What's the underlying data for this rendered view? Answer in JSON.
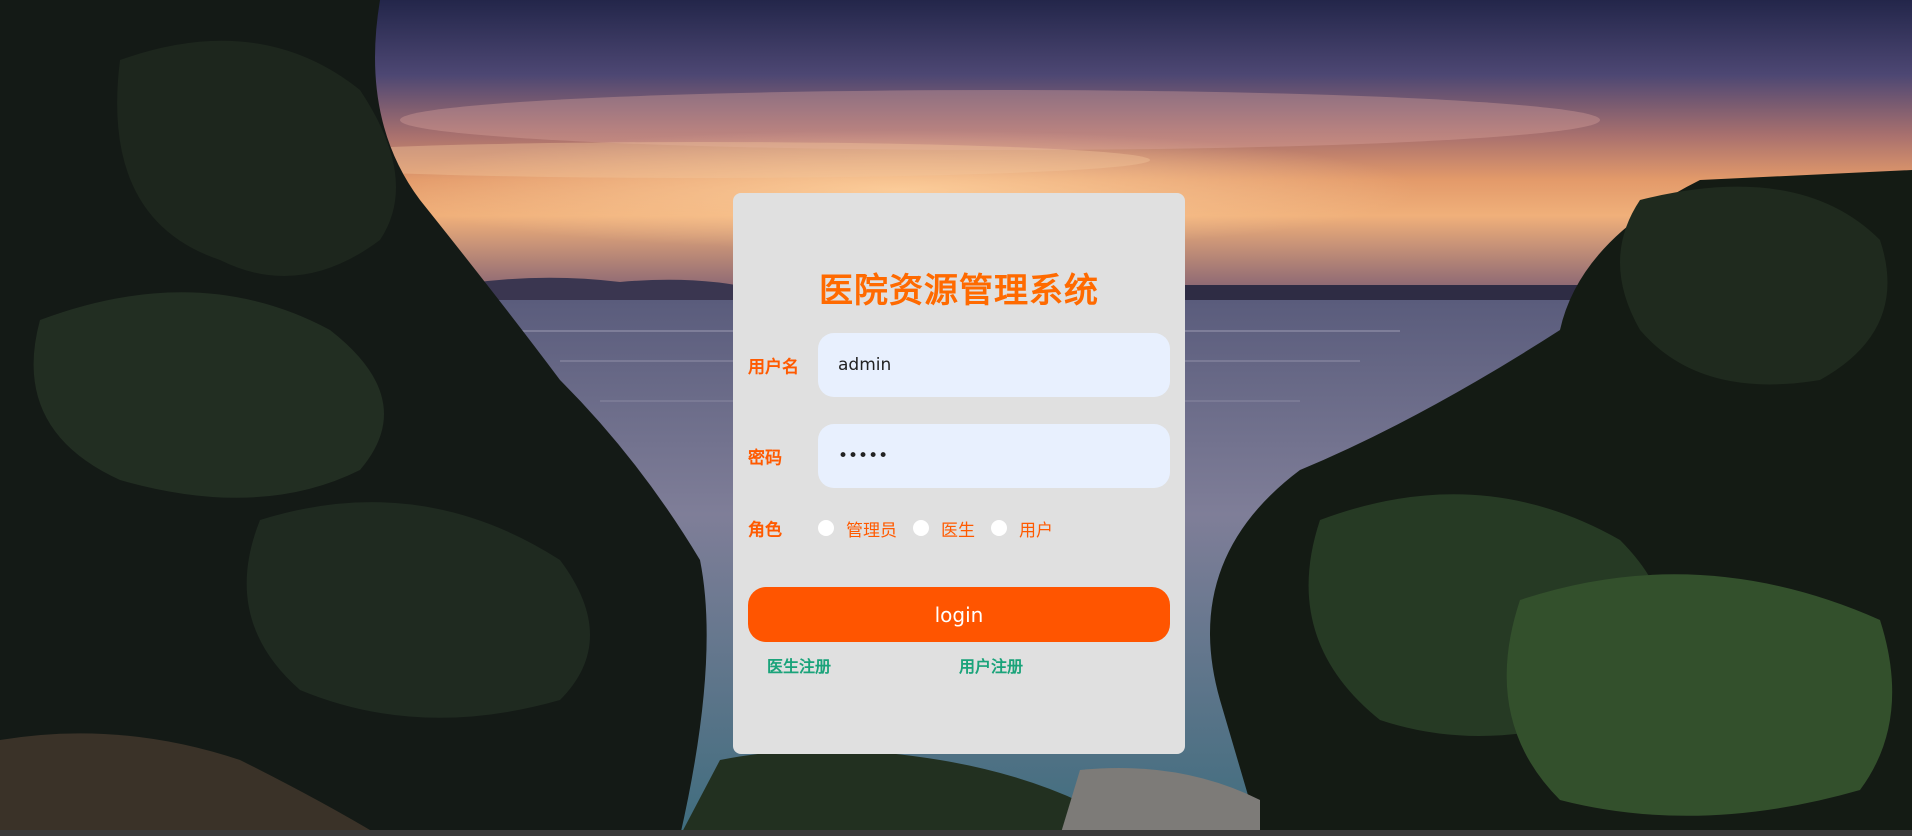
{
  "login": {
    "title": "医院资源管理系统",
    "username_label": "用户名",
    "username_value": "admin",
    "password_label": "密码",
    "password_value": "•••••",
    "role_label": "角色",
    "roles": [
      {
        "label": "管理员",
        "selected": false
      },
      {
        "label": "医生",
        "selected": false
      },
      {
        "label": "用户",
        "selected": false
      }
    ],
    "login_button": "login",
    "doctor_register_link": "医生注册",
    "user_register_link": "用户注册"
  },
  "colors": {
    "accent": "#ff5500",
    "title": "#ff6a00",
    "link": "#1aa37a",
    "card": "#e0e0e0",
    "input_bg": "#e8f0fe"
  }
}
